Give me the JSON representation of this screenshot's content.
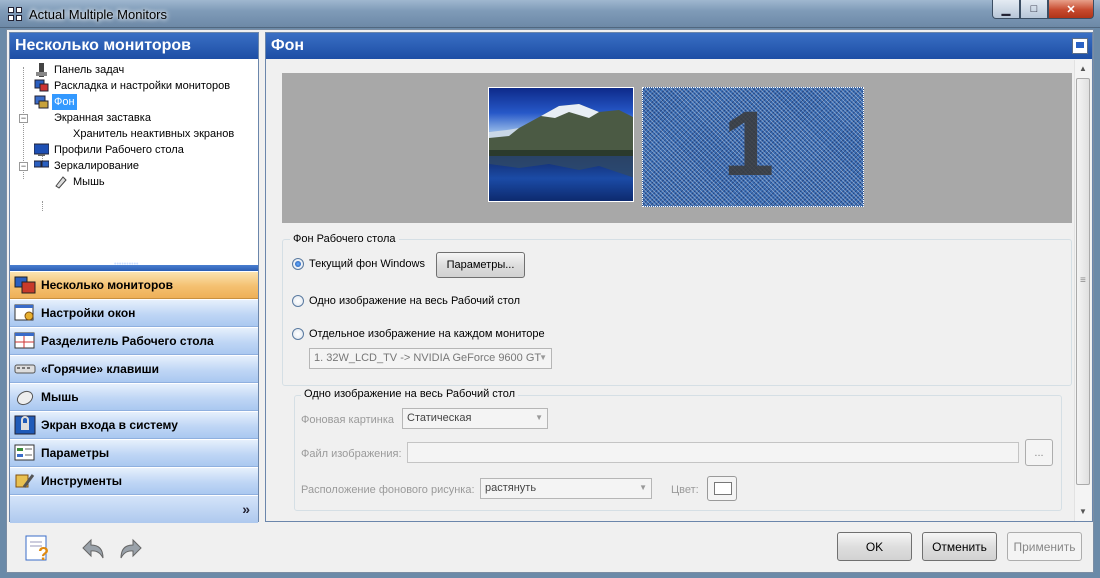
{
  "window": {
    "title": "Actual Multiple Monitors",
    "minimize": "▁",
    "maximize": "□",
    "close": "✕"
  },
  "left_pane": {
    "header": "Несколько мониторов",
    "tree": [
      {
        "label": "Панель задач",
        "icon": "taskbar-icon"
      },
      {
        "label": "Раскладка и настройки мониторов",
        "icon": "monitors-layout-icon"
      },
      {
        "label": "Фон",
        "icon": "wallpaper-icon",
        "selected": true
      },
      {
        "label": "Экранная заставка",
        "icon": "screensaver-icon",
        "expander": "−"
      },
      {
        "label": "Хранитель неактивных экранов",
        "icon": "none"
      },
      {
        "label": "Профили Рабочего стола",
        "icon": "desktop-profiles-icon"
      },
      {
        "label": "Зеркалирование",
        "icon": "mirroring-icon",
        "expander": "−"
      },
      {
        "label": "Мышь",
        "icon": "mouse-icon"
      }
    ],
    "nav": [
      {
        "label": "Несколько мониторов",
        "icon": "multi-monitor-icon",
        "active": true
      },
      {
        "label": "Настройки окон",
        "icon": "window-settings-icon"
      },
      {
        "label": "Разделитель Рабочего стола",
        "icon": "desktop-divider-icon"
      },
      {
        "label": "«Горячие» клавиши",
        "icon": "hotkeys-icon"
      },
      {
        "label": "Мышь",
        "icon": "mouse-icon"
      },
      {
        "label": "Экран входа в систему",
        "icon": "logon-screen-icon"
      },
      {
        "label": "Параметры",
        "icon": "options-icon"
      },
      {
        "label": "Инструменты",
        "icon": "tools-icon"
      }
    ],
    "more_glyph": "»"
  },
  "right_pane": {
    "header": "Фон",
    "preview": {
      "monitor2_number": "1"
    },
    "desktop_bg": {
      "title": "Фон Рабочего стола",
      "opt_current": "Текущий фон Windows",
      "params_button": "Параметры...",
      "opt_single": "Одно изображение на весь Рабочий стол",
      "opt_each": "Отдельное изображение на каждом мониторе",
      "monitor_select": "1. 32W_LCD_TV -> NVIDIA GeForce 9600 GT",
      "selected_option": "current"
    },
    "single_image": {
      "title": "Одно изображение на весь Рабочий стол",
      "picture_label": "Фоновая картинка",
      "picture_value": "Статическая",
      "file_label": "Файл изображения:",
      "file_value": "",
      "browse_button": "...",
      "position_label": "Расположение фонового рисунка:",
      "position_value": "растянуть",
      "color_label": "Цвет:",
      "color_value": "#ffffff"
    }
  },
  "bottom": {
    "ok": "OK",
    "cancel": "Отменить",
    "apply": "Применить"
  }
}
